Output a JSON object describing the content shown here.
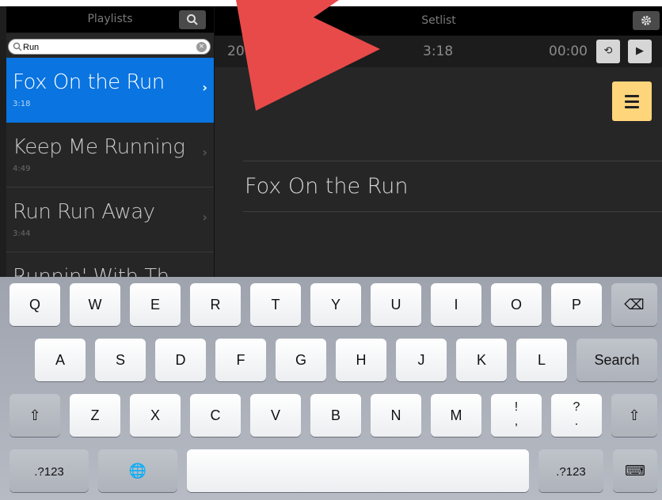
{
  "left_pane": {
    "title": "Playlists",
    "search": {
      "value": "Run",
      "clear": "×"
    },
    "songs": [
      {
        "title": "Fox On the Run",
        "duration": "3:18",
        "chevron": "›"
      },
      {
        "title": "Keep Me Running",
        "duration": "4:49",
        "chevron": "›"
      },
      {
        "title": "Run Run Away",
        "duration": "3:44",
        "chevron": "›"
      },
      {
        "title": "Runnin' With Th",
        "duration": "",
        "chevron": ""
      }
    ]
  },
  "right_pane": {
    "title": "Setlist",
    "clock": "20:59:09",
    "duration": "3:18",
    "elapsed": "00:00",
    "loop_glyph": "⟲",
    "play_glyph": "▶",
    "current_song": "Fox On the Run"
  },
  "keyboard": {
    "row1": [
      "Q",
      "W",
      "E",
      "R",
      "T",
      "Y",
      "U",
      "I",
      "O",
      "P"
    ],
    "row2": [
      "A",
      "S",
      "D",
      "F",
      "G",
      "H",
      "J",
      "K",
      "L"
    ],
    "row3": [
      "Z",
      "X",
      "C",
      "V",
      "B",
      "N",
      "M"
    ],
    "search_label": "Search",
    "exclaim": [
      "!",
      ","
    ],
    "question": [
      "?",
      "."
    ],
    "numbers_label": ".?123",
    "shift_glyph": "⇧",
    "backspace_glyph": "⌫",
    "globe_glyph": "🌐",
    "hide_glyph": "⌨"
  },
  "colors": {
    "selected_row": "#0a74e0",
    "menu_button": "#ffd57c",
    "pointer_overlay": "#e84a4a"
  }
}
